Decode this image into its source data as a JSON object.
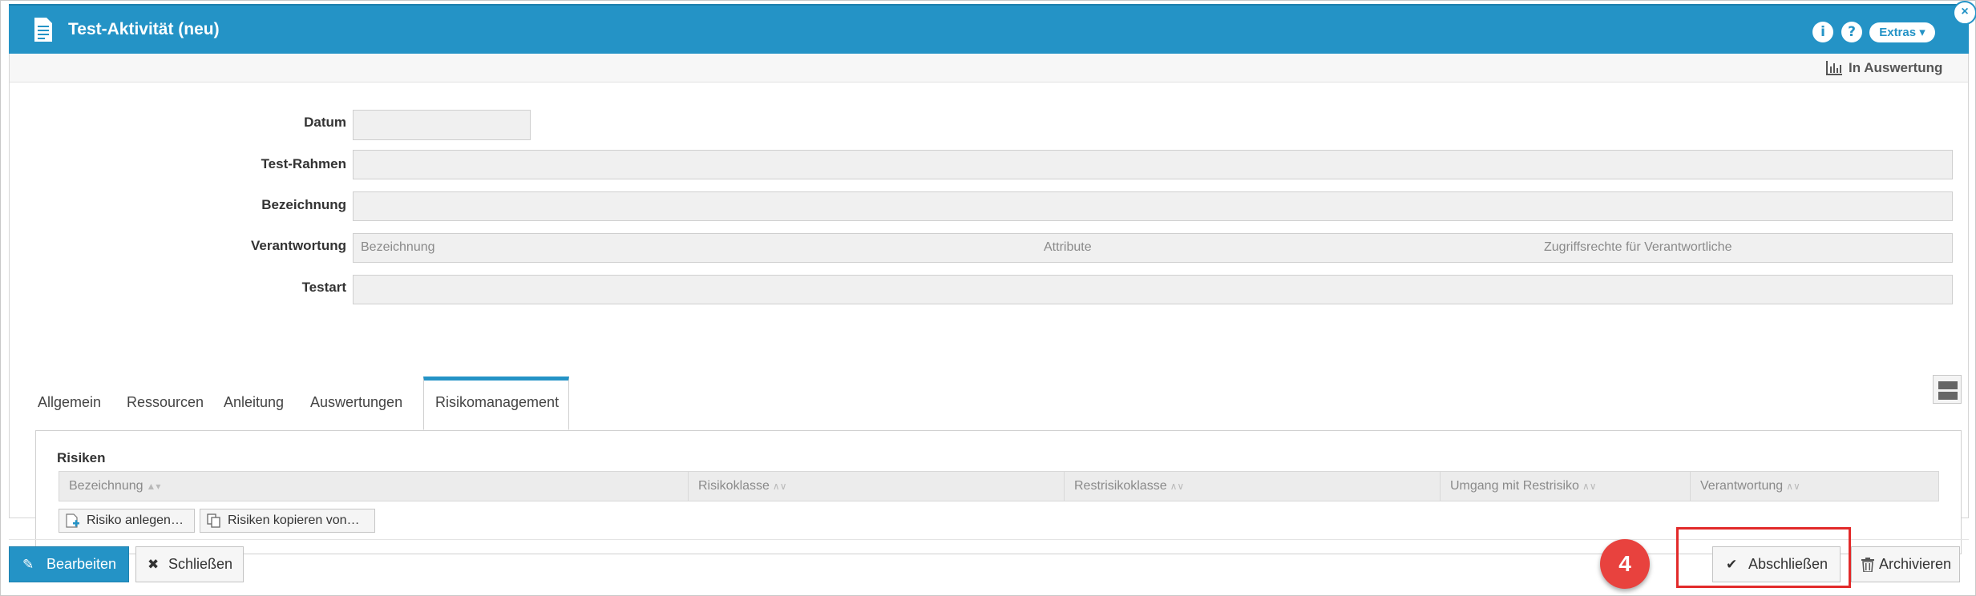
{
  "header": {
    "title": "Test-Aktivität (neu)",
    "extras_label": "Extras ▾",
    "info_icon": "info-icon",
    "help_icon": "help-icon",
    "close_glyph": "×"
  },
  "status": {
    "label": "In Auswertung"
  },
  "form": {
    "datum_label": "Datum",
    "rahmen_label": "Test-Rahmen",
    "bezeichnung_label": "Bezeichnung",
    "verantwortung_label": "Verantwortung",
    "testart_label": "Testart",
    "verantwortung_columns": [
      "Bezeichnung",
      "Attribute",
      "Zugriffsrechte für Verantwortliche"
    ]
  },
  "tabs": [
    "Allgemein",
    "Ressourcen",
    "Anleitung",
    "Auswertungen",
    "Risikomanagement"
  ],
  "active_tab": "Risikomanagement",
  "risiken": {
    "title": "Risiken",
    "columns": [
      "Bezeichnung",
      "Risikoklasse",
      "Restrisikoklasse",
      "Umgang mit Restrisiko",
      "Verantwortung"
    ],
    "sort_indicators": [
      "▲▾",
      "∧∨",
      "∧∨",
      "∧∨",
      "∧∨"
    ],
    "add_button": "Risiko anlegen…",
    "copy_button": "Risiken kopieren von…"
  },
  "footer": {
    "edit_button": "Bearbeiten",
    "close_button": "Schließen",
    "finish_button": "Abschließen",
    "archive_button": "Archivieren",
    "step_badge": "4"
  },
  "colors": {
    "accent": "#2493c6",
    "badge": "#e8423e",
    "highlight": "#e22a2a"
  }
}
